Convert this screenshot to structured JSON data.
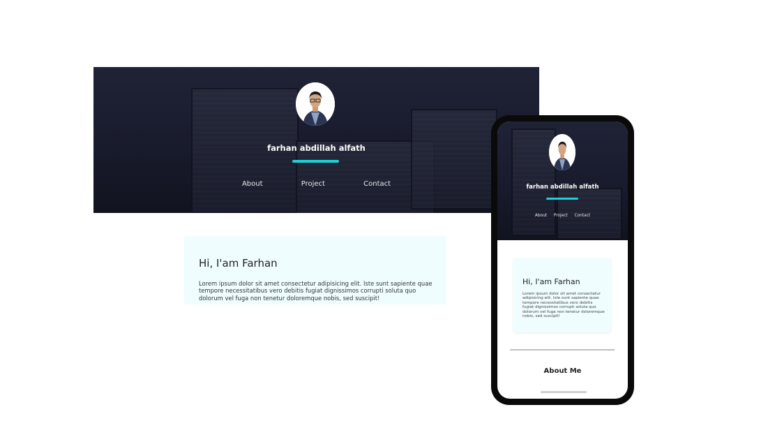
{
  "profile": {
    "name": "farhan abdillah alfath",
    "avatar_icon": "person-photo-icon"
  },
  "nav": {
    "items": [
      "About",
      "Project",
      "Contact"
    ]
  },
  "intro": {
    "heading": "Hi, I'am Farhan",
    "body": "Lorem ipsum dolor sit amet consectetur adipisicing elit. Iste sunt sapiente quae tempore necessitatibus vero debitis fugiat dignissimos corrupti soluta quo dolorum vel fuga non tenetur doloremque nobis, sed suscipit!"
  },
  "mobile": {
    "section_title": "About Me"
  },
  "colors": {
    "accent": "#1fd0d8",
    "card_bg": "#effdff",
    "hero_dark": "#1d2033"
  }
}
